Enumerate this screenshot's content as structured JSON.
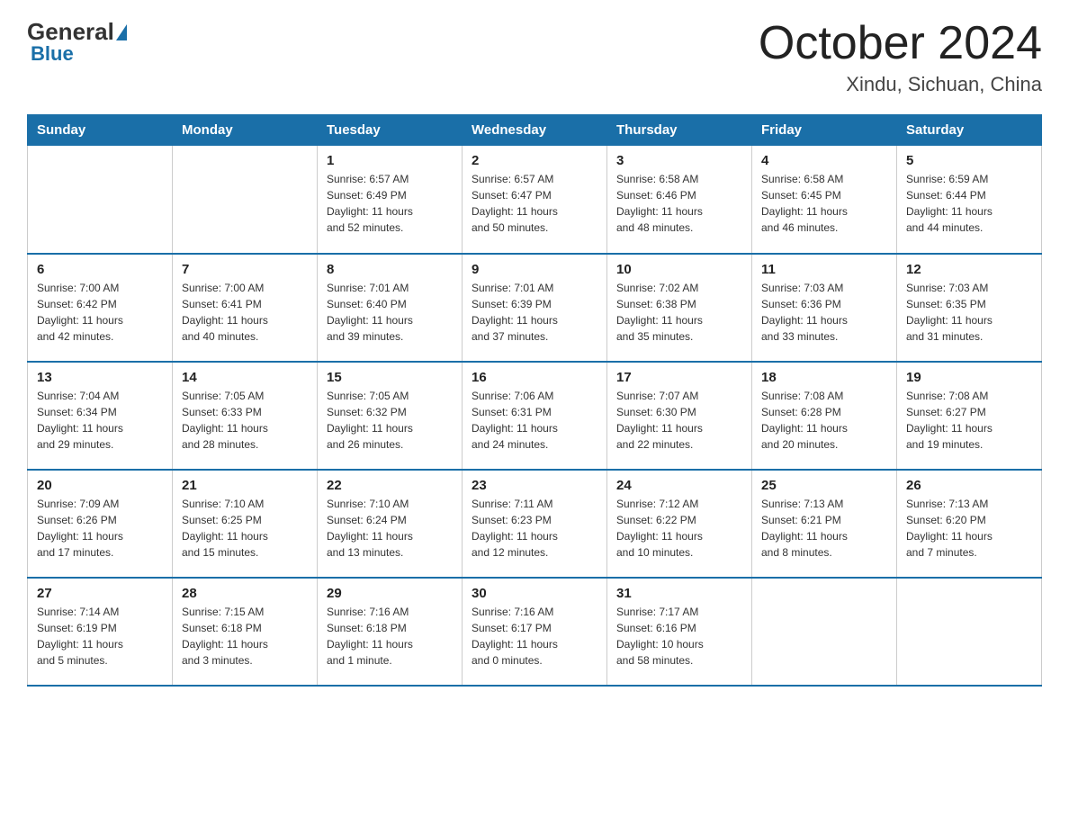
{
  "logo": {
    "general": "General",
    "blue": "Blue"
  },
  "title": "October 2024",
  "location": "Xindu, Sichuan, China",
  "headers": [
    "Sunday",
    "Monday",
    "Tuesday",
    "Wednesday",
    "Thursday",
    "Friday",
    "Saturday"
  ],
  "weeks": [
    [
      {
        "day": "",
        "info": ""
      },
      {
        "day": "",
        "info": ""
      },
      {
        "day": "1",
        "info": "Sunrise: 6:57 AM\nSunset: 6:49 PM\nDaylight: 11 hours\nand 52 minutes."
      },
      {
        "day": "2",
        "info": "Sunrise: 6:57 AM\nSunset: 6:47 PM\nDaylight: 11 hours\nand 50 minutes."
      },
      {
        "day": "3",
        "info": "Sunrise: 6:58 AM\nSunset: 6:46 PM\nDaylight: 11 hours\nand 48 minutes."
      },
      {
        "day": "4",
        "info": "Sunrise: 6:58 AM\nSunset: 6:45 PM\nDaylight: 11 hours\nand 46 minutes."
      },
      {
        "day": "5",
        "info": "Sunrise: 6:59 AM\nSunset: 6:44 PM\nDaylight: 11 hours\nand 44 minutes."
      }
    ],
    [
      {
        "day": "6",
        "info": "Sunrise: 7:00 AM\nSunset: 6:42 PM\nDaylight: 11 hours\nand 42 minutes."
      },
      {
        "day": "7",
        "info": "Sunrise: 7:00 AM\nSunset: 6:41 PM\nDaylight: 11 hours\nand 40 minutes."
      },
      {
        "day": "8",
        "info": "Sunrise: 7:01 AM\nSunset: 6:40 PM\nDaylight: 11 hours\nand 39 minutes."
      },
      {
        "day": "9",
        "info": "Sunrise: 7:01 AM\nSunset: 6:39 PM\nDaylight: 11 hours\nand 37 minutes."
      },
      {
        "day": "10",
        "info": "Sunrise: 7:02 AM\nSunset: 6:38 PM\nDaylight: 11 hours\nand 35 minutes."
      },
      {
        "day": "11",
        "info": "Sunrise: 7:03 AM\nSunset: 6:36 PM\nDaylight: 11 hours\nand 33 minutes."
      },
      {
        "day": "12",
        "info": "Sunrise: 7:03 AM\nSunset: 6:35 PM\nDaylight: 11 hours\nand 31 minutes."
      }
    ],
    [
      {
        "day": "13",
        "info": "Sunrise: 7:04 AM\nSunset: 6:34 PM\nDaylight: 11 hours\nand 29 minutes."
      },
      {
        "day": "14",
        "info": "Sunrise: 7:05 AM\nSunset: 6:33 PM\nDaylight: 11 hours\nand 28 minutes."
      },
      {
        "day": "15",
        "info": "Sunrise: 7:05 AM\nSunset: 6:32 PM\nDaylight: 11 hours\nand 26 minutes."
      },
      {
        "day": "16",
        "info": "Sunrise: 7:06 AM\nSunset: 6:31 PM\nDaylight: 11 hours\nand 24 minutes."
      },
      {
        "day": "17",
        "info": "Sunrise: 7:07 AM\nSunset: 6:30 PM\nDaylight: 11 hours\nand 22 minutes."
      },
      {
        "day": "18",
        "info": "Sunrise: 7:08 AM\nSunset: 6:28 PM\nDaylight: 11 hours\nand 20 minutes."
      },
      {
        "day": "19",
        "info": "Sunrise: 7:08 AM\nSunset: 6:27 PM\nDaylight: 11 hours\nand 19 minutes."
      }
    ],
    [
      {
        "day": "20",
        "info": "Sunrise: 7:09 AM\nSunset: 6:26 PM\nDaylight: 11 hours\nand 17 minutes."
      },
      {
        "day": "21",
        "info": "Sunrise: 7:10 AM\nSunset: 6:25 PM\nDaylight: 11 hours\nand 15 minutes."
      },
      {
        "day": "22",
        "info": "Sunrise: 7:10 AM\nSunset: 6:24 PM\nDaylight: 11 hours\nand 13 minutes."
      },
      {
        "day": "23",
        "info": "Sunrise: 7:11 AM\nSunset: 6:23 PM\nDaylight: 11 hours\nand 12 minutes."
      },
      {
        "day": "24",
        "info": "Sunrise: 7:12 AM\nSunset: 6:22 PM\nDaylight: 11 hours\nand 10 minutes."
      },
      {
        "day": "25",
        "info": "Sunrise: 7:13 AM\nSunset: 6:21 PM\nDaylight: 11 hours\nand 8 minutes."
      },
      {
        "day": "26",
        "info": "Sunrise: 7:13 AM\nSunset: 6:20 PM\nDaylight: 11 hours\nand 7 minutes."
      }
    ],
    [
      {
        "day": "27",
        "info": "Sunrise: 7:14 AM\nSunset: 6:19 PM\nDaylight: 11 hours\nand 5 minutes."
      },
      {
        "day": "28",
        "info": "Sunrise: 7:15 AM\nSunset: 6:18 PM\nDaylight: 11 hours\nand 3 minutes."
      },
      {
        "day": "29",
        "info": "Sunrise: 7:16 AM\nSunset: 6:18 PM\nDaylight: 11 hours\nand 1 minute."
      },
      {
        "day": "30",
        "info": "Sunrise: 7:16 AM\nSunset: 6:17 PM\nDaylight: 11 hours\nand 0 minutes."
      },
      {
        "day": "31",
        "info": "Sunrise: 7:17 AM\nSunset: 6:16 PM\nDaylight: 10 hours\nand 58 minutes."
      },
      {
        "day": "",
        "info": ""
      },
      {
        "day": "",
        "info": ""
      }
    ]
  ]
}
